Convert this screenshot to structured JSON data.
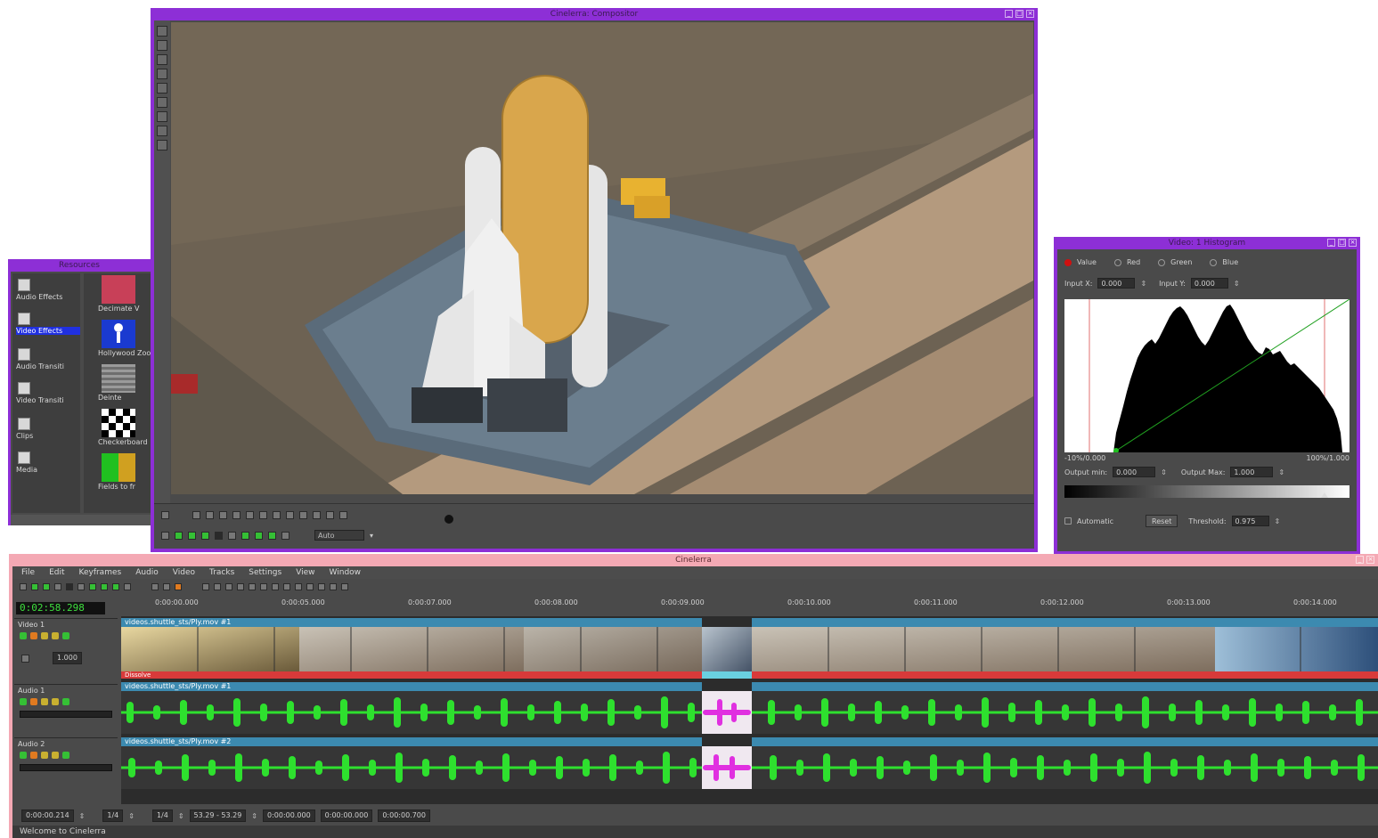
{
  "compositor": {
    "title": "Cinelerra: Compositor",
    "zoom": "Auto"
  },
  "resources": {
    "title": "Resources",
    "folders": [
      {
        "label": "Audio Effects",
        "selected": false
      },
      {
        "label": "Video Effects",
        "selected": true
      },
      {
        "label": "Audio Transiti",
        "selected": false
      },
      {
        "label": "Video Transiti",
        "selected": false
      },
      {
        "label": "Clips",
        "selected": false
      },
      {
        "label": "Media",
        "selected": false
      }
    ],
    "items": [
      {
        "label": "Decimate V",
        "icon": "decimate-icon"
      },
      {
        "label": "Hollywood Zoom",
        "icon": "figure-icon"
      },
      {
        "label": "Deinte",
        "icon": "deinterlace-icon"
      },
      {
        "label": "Checkerboard",
        "icon": "checker-icon"
      },
      {
        "label": "Fields to fr",
        "icon": "fields-icon"
      }
    ]
  },
  "histogram": {
    "title": "Video: 1 Histogram",
    "modes": [
      {
        "label": "Value",
        "selected": true
      },
      {
        "label": "Red",
        "selected": false
      },
      {
        "label": "Green",
        "selected": false
      },
      {
        "label": "Blue",
        "selected": false
      }
    ],
    "input_x_label": "Input X:",
    "input_x_value": "0.000",
    "input_y_label": "Input Y:",
    "input_y_value": "0.000",
    "range_min": "-10%/0.000",
    "range_max": "100%/1.000",
    "output_min_label": "Output min:",
    "output_min_value": "0.000",
    "output_max_label": "Output Max:",
    "output_max_value": "1.000",
    "automatic_label": "Automatic",
    "reset_label": "Reset",
    "threshold_label": "Threshold:",
    "threshold_value": "0.975"
  },
  "main": {
    "title": "Cinelerra",
    "menu": [
      "File",
      "Edit",
      "Keyframes",
      "Audio",
      "Video",
      "Tracks",
      "Settings",
      "View",
      "Window"
    ],
    "clock": "0:02:58.298",
    "ruler": [
      "0:00:00.000",
      "0:00:05.000",
      "0:00:07.000",
      "0:00:08.000",
      "0:00:09.000",
      "0:00:10.000",
      "0:00:11.000",
      "0:00:12.000",
      "0:00:13.000",
      "0:00:14.000"
    ],
    "tracks": [
      {
        "name": "Video 1",
        "kind": "video",
        "edit_title": "videos.shuttle_sts/Ply.mov #1",
        "zoom": "1.000"
      },
      {
        "name": "Audio 1",
        "kind": "audio",
        "edit_title": "videos.shuttle_sts/Ply.mov #1"
      },
      {
        "name": "Audio 2",
        "kind": "audio",
        "edit_title": "videos.shuttle_sts/Ply.mov #2"
      }
    ],
    "transition_label": "Dissolve",
    "status_fields": [
      "0:00:00.214",
      "1/4",
      "1/4",
      "53.29 - 53.29",
      "0:00:00.000",
      "0:00:00.000",
      "0:00:00.700"
    ],
    "status_text": "Welcome to Cinelerra"
  }
}
